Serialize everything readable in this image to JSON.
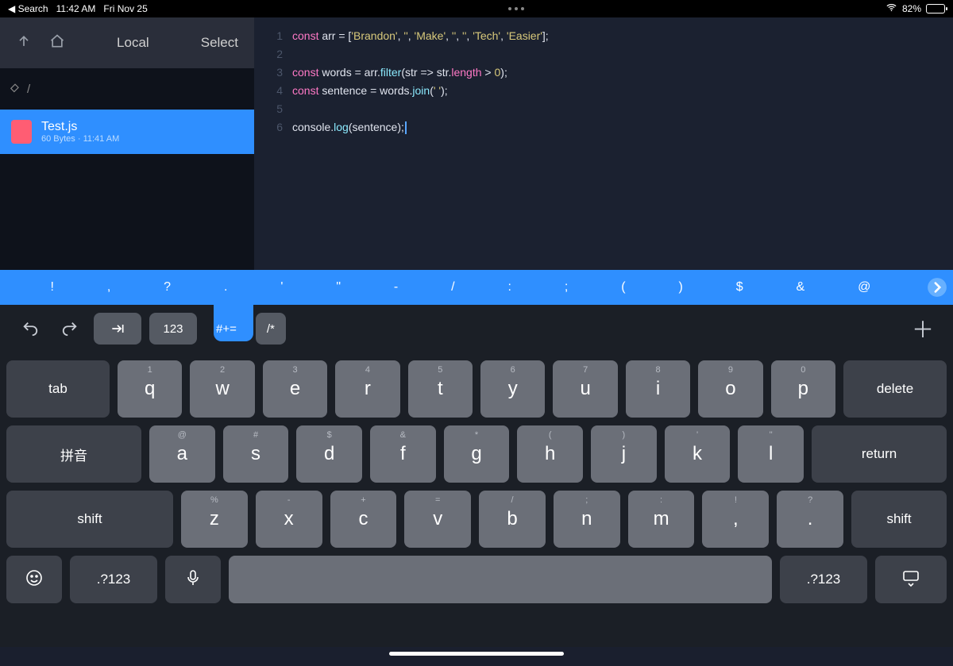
{
  "status": {
    "back": "◀ Search",
    "time": "11:42 AM",
    "date": "Fri Nov 25",
    "battery_pct": "82%",
    "battery_fill": 82
  },
  "sidebar": {
    "location_label": "Local",
    "select_label": "Select",
    "path": "/",
    "file": {
      "name": "Test.js",
      "meta": "60 Bytes · 11:41 AM"
    }
  },
  "code": {
    "lines": [
      [
        {
          "t": "const ",
          "c": "kw"
        },
        {
          "t": "arr ",
          "c": "id"
        },
        {
          "t": "= [",
          "c": "op"
        },
        {
          "t": "'Brandon'",
          "c": "str"
        },
        {
          "t": ", ",
          "c": "punct"
        },
        {
          "t": "''",
          "c": "str"
        },
        {
          "t": ", ",
          "c": "punct"
        },
        {
          "t": "'Make'",
          "c": "str"
        },
        {
          "t": ", ",
          "c": "punct"
        },
        {
          "t": "''",
          "c": "str"
        },
        {
          "t": ", ",
          "c": "punct"
        },
        {
          "t": "''",
          "c": "str"
        },
        {
          "t": ", ",
          "c": "punct"
        },
        {
          "t": "'Tech'",
          "c": "str"
        },
        {
          "t": ", ",
          "c": "punct"
        },
        {
          "t": "'Easier'",
          "c": "str"
        },
        {
          "t": "];",
          "c": "punct"
        }
      ],
      [],
      [
        {
          "t": "const ",
          "c": "kw"
        },
        {
          "t": "words ",
          "c": "id"
        },
        {
          "t": "= arr.",
          "c": "op"
        },
        {
          "t": "filter",
          "c": "fn"
        },
        {
          "t": "(str ",
          "c": "punct"
        },
        {
          "t": "=>",
          "c": "op"
        },
        {
          "t": " str.",
          "c": "id"
        },
        {
          "t": "length",
          "c": "prop"
        },
        {
          "t": " > ",
          "c": "op"
        },
        {
          "t": "0",
          "c": "num"
        },
        {
          "t": ");",
          "c": "punct"
        }
      ],
      [
        {
          "t": "const ",
          "c": "kw"
        },
        {
          "t": "sentence ",
          "c": "id"
        },
        {
          "t": "= words.",
          "c": "op"
        },
        {
          "t": "join",
          "c": "fn"
        },
        {
          "t": "(",
          "c": "punct"
        },
        {
          "t": "' '",
          "c": "str"
        },
        {
          "t": ");",
          "c": "punct"
        }
      ],
      [],
      [
        {
          "t": "console.",
          "c": "id"
        },
        {
          "t": "log",
          "c": "fn"
        },
        {
          "t": "(sentence);",
          "c": "punct"
        }
      ]
    ]
  },
  "symbar": [
    "!",
    ",",
    "?",
    ".",
    "'",
    "\"",
    "-",
    "/",
    ":",
    ";",
    "(",
    ")",
    "$",
    "&",
    "@"
  ],
  "accessory": {
    "num_key": "123",
    "sym_key": "#+=",
    "comment_key": "/*"
  },
  "keyboard": {
    "row1": {
      "side_l": "tab",
      "keys": [
        "q",
        "w",
        "e",
        "r",
        "t",
        "y",
        "u",
        "i",
        "o",
        "p"
      ],
      "alts": [
        "1",
        "2",
        "3",
        "4",
        "5",
        "6",
        "7",
        "8",
        "9",
        "0"
      ],
      "side_r": "delete"
    },
    "row2": {
      "side_l": "拼音",
      "keys": [
        "a",
        "s",
        "d",
        "f",
        "g",
        "h",
        "j",
        "k",
        "l"
      ],
      "alts": [
        "@",
        "#",
        "$",
        "&",
        "*",
        "(",
        ")",
        "'",
        "\""
      ],
      "side_r": "return"
    },
    "row3": {
      "side_l": "shift",
      "keys": [
        "z",
        "x",
        "c",
        "v",
        "b",
        "n",
        "m"
      ],
      "alts": [
        "%",
        "-",
        "+",
        "=",
        "/",
        ";",
        ":"
      ],
      "extra": [
        {
          "m": ",",
          "a": "!"
        },
        {
          "m": ".",
          "a": "?"
        }
      ],
      "side_r": "shift"
    },
    "row4": {
      "num": ".?123",
      "num_r": ".?123"
    }
  }
}
